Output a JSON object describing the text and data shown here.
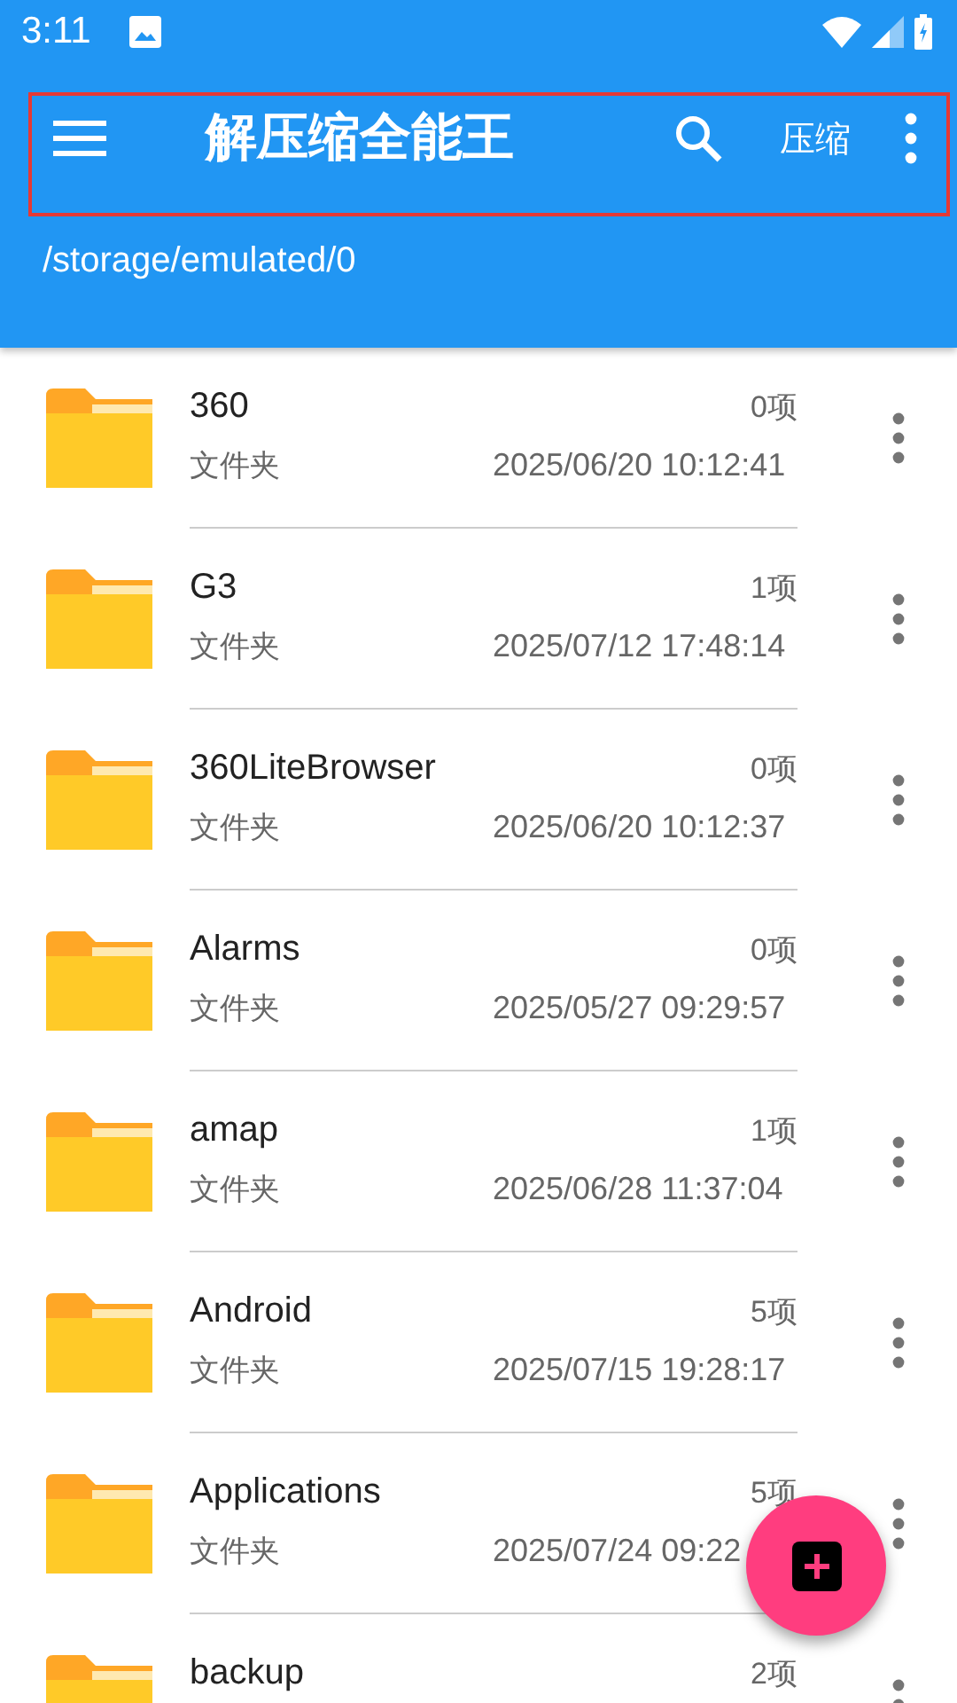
{
  "status_bar": {
    "time": "3:11"
  },
  "toolbar": {
    "title": "解压缩全能王",
    "action": "压缩"
  },
  "path": "/storage/emulated/0",
  "files": [
    {
      "name": "360",
      "type": "文件夹",
      "count": "0项",
      "date": "2025/06/20 10:12:41"
    },
    {
      "name": "G3",
      "type": "文件夹",
      "count": "1项",
      "date": "2025/07/12 17:48:14"
    },
    {
      "name": "360LiteBrowser",
      "type": "文件夹",
      "count": "0项",
      "date": "2025/06/20 10:12:37"
    },
    {
      "name": "Alarms",
      "type": "文件夹",
      "count": "0项",
      "date": "2025/05/27 09:29:57"
    },
    {
      "name": "amap",
      "type": "文件夹",
      "count": "1项",
      "date": "2025/06/28 11:37:04"
    },
    {
      "name": "Android",
      "type": "文件夹",
      "count": "5项",
      "date": "2025/07/15 19:28:17"
    },
    {
      "name": "Applications",
      "type": "文件夹",
      "count": "5项",
      "date": "2025/07/24 09:22"
    },
    {
      "name": "backup",
      "count": "2项"
    }
  ]
}
